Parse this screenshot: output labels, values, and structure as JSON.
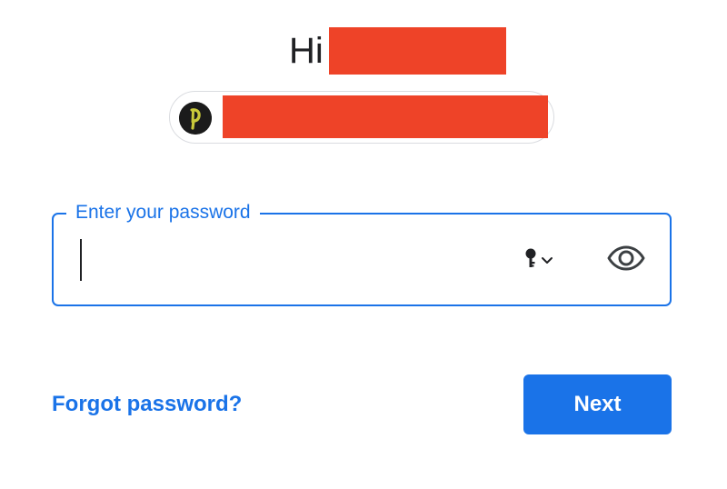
{
  "greeting": {
    "text": "Hi",
    "name_redacted": true,
    "redaction_color": "#ee4328"
  },
  "account": {
    "avatar_icon": "account-avatar-icon",
    "email_redacted": true
  },
  "password_field": {
    "label": "Enter your password",
    "value": "",
    "key_icon": "key-icon",
    "dropdown_icon": "chevron-down-icon",
    "visibility_icon": "eye-icon"
  },
  "actions": {
    "forgot_label": "Forgot password?",
    "next_label": "Next"
  },
  "colors": {
    "accent": "#1a73e8",
    "text": "#202124",
    "chip_border": "#dadce0"
  }
}
